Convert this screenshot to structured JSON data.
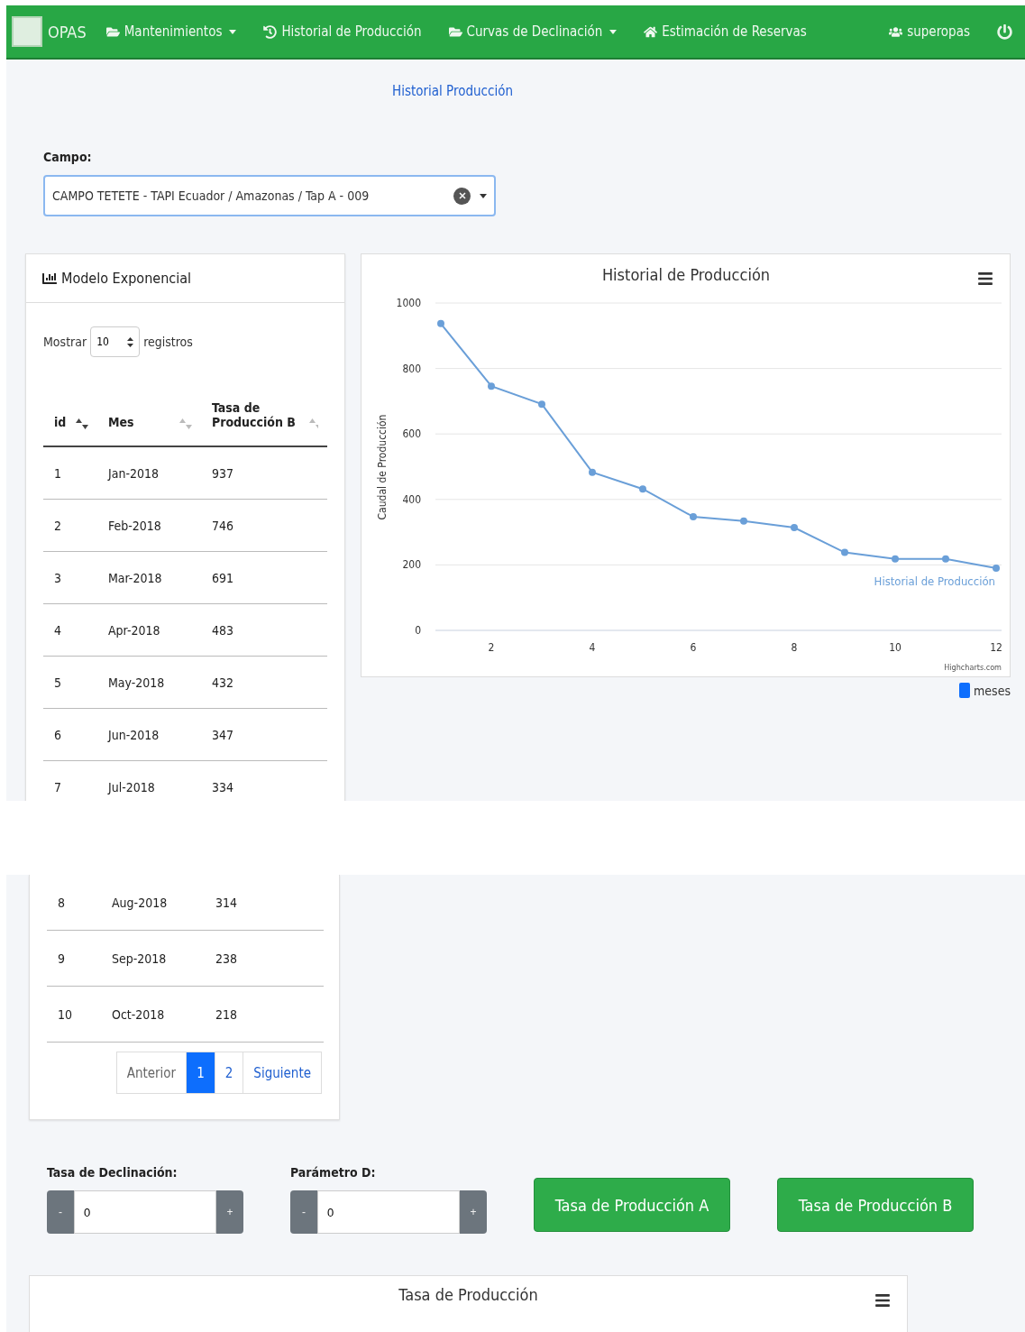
{
  "navbar": {
    "brand": "OPAS",
    "items": [
      {
        "label": "Mantenimientos",
        "kind": "folder",
        "dropdown": true
      },
      {
        "label": "Historial de Producción",
        "kind": "history",
        "dropdown": false
      },
      {
        "label": "Curvas de Declinación",
        "kind": "folder",
        "dropdown": true
      },
      {
        "label": "Estimación de Reservas",
        "kind": "home",
        "dropdown": false
      }
    ],
    "user": "superopas"
  },
  "breadcrumb": "Historial Producción",
  "campo": {
    "label": "Campo:",
    "value": "CAMPO TETETE - TAPI Ecuador / Amazonas / Tap A - 009"
  },
  "table_card": {
    "title": "Modelo Exponencial",
    "show_before": "Mostrar",
    "page_size": "10",
    "show_after": "registros",
    "columns": [
      {
        "label": "id",
        "sorted": true
      },
      {
        "label": "Mes",
        "sorted": false
      },
      {
        "label": "Tasa de Producción B",
        "sorted": false
      }
    ],
    "rows": [
      [
        "1",
        "Jan-2018",
        "937"
      ],
      [
        "2",
        "Feb-2018",
        "746"
      ],
      [
        "3",
        "Mar-2018",
        "691"
      ],
      [
        "4",
        "Apr-2018",
        "483"
      ],
      [
        "5",
        "May-2018",
        "432"
      ],
      [
        "6",
        "Jun-2018",
        "347"
      ],
      [
        "7",
        "Jul-2018",
        "334"
      ],
      [
        "8",
        "Aug-2018",
        "314"
      ],
      [
        "9",
        "Sep-2018",
        "238"
      ],
      [
        "10",
        "Oct-2018",
        "218"
      ]
    ],
    "pagination": [
      {
        "label": "Anterior",
        "kind": "prev",
        "selected": false
      },
      {
        "label": "1",
        "kind": "page",
        "selected": true
      },
      {
        "label": "2",
        "kind": "page",
        "selected": false
      },
      {
        "label": "Siguiente",
        "kind": "next",
        "selected": false
      }
    ]
  },
  "history_chart": {
    "credit": "Highcharts.com",
    "legend": "meses",
    "chart_data": {
      "type": "line",
      "grid": true,
      "title": "Historial de Producción",
      "ylabel": "Caudal de Producción",
      "x": [
        1,
        2,
        3,
        4,
        5,
        6,
        7,
        8,
        9,
        10,
        11,
        12
      ],
      "xlim": [
        1,
        12
      ],
      "ylim": [
        0,
        1000
      ],
      "xticks": [
        2,
        4,
        6,
        8,
        10,
        12
      ],
      "yticks": [
        0,
        200,
        400,
        600,
        800,
        1000
      ],
      "series": [
        {
          "name": "Historial de Producción",
          "color": "#6a9fd8",
          "marker": true,
          "values": [
            937,
            746,
            691,
            483,
            432,
            347,
            334,
            314,
            238,
            218,
            218,
            190
          ]
        }
      ]
    }
  },
  "controls": [
    {
      "label": "Tasa de Declinación:",
      "minus": "-",
      "value": "0",
      "plus": "+"
    },
    {
      "label": "Parámetro D:",
      "minus": "-",
      "value": "0",
      "plus": "+"
    }
  ],
  "buttons": [
    "Tasa de Producción A",
    "Tasa de Producción B"
  ],
  "rate_chart": {
    "title": "Tasa de Producción"
  }
}
